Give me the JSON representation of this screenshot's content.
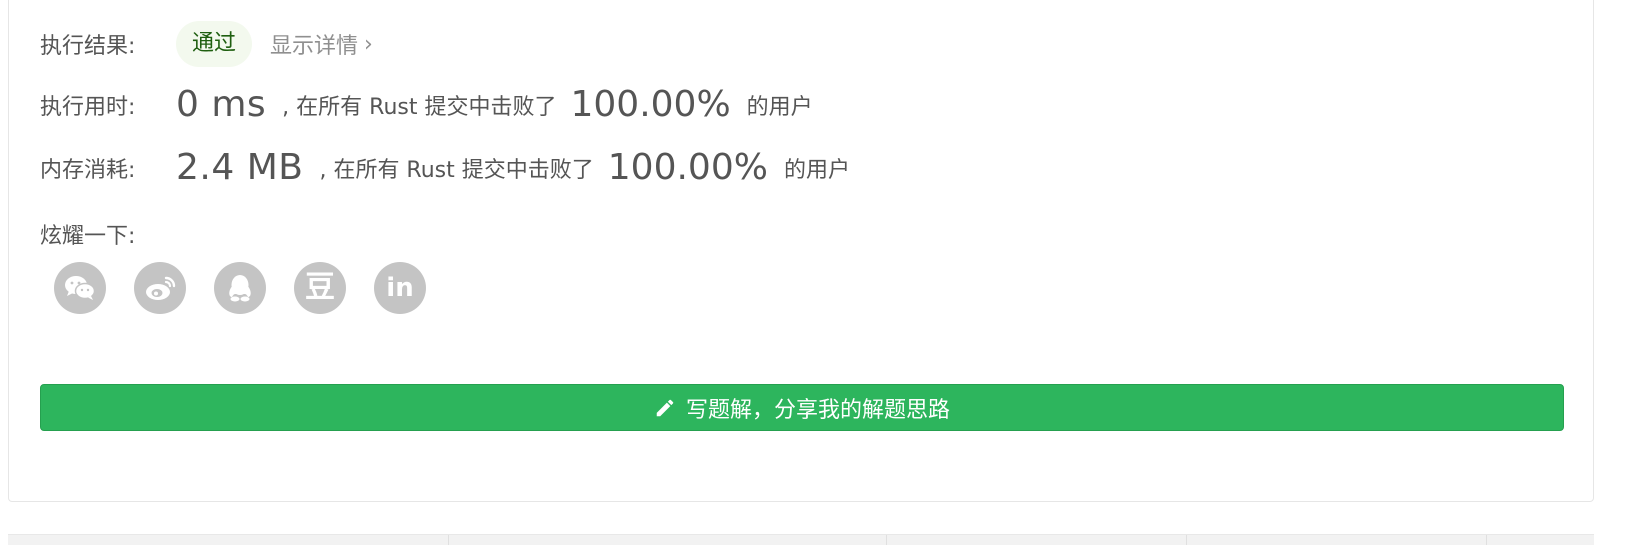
{
  "result": {
    "label": "执行结果:",
    "status": "通过",
    "details_link": "显示详情",
    "details_chevron": "›"
  },
  "runtime": {
    "label": "执行用时:",
    "value": "0 ms",
    "sentence": ", 在所有 Rust 提交中击败了",
    "percent": "100.00%",
    "tail": "的用户"
  },
  "memory": {
    "label": "内存消耗:",
    "value": "2.4 MB",
    "sentence": ", 在所有 Rust 提交中击败了",
    "percent": "100.00%",
    "tail": "的用户"
  },
  "share": {
    "label": "炫耀一下:",
    "icons": [
      "wechat-icon",
      "weibo-icon",
      "qq-icon",
      "douban-icon",
      "linkedin-icon"
    ],
    "douban_glyph": "豆",
    "linkedin_glyph": "in"
  },
  "write_solution": {
    "label": "写题解，分享我的解题思路",
    "icon": "pencil-icon"
  },
  "colors": {
    "accent_green": "#2db55d",
    "pill_bg": "#f3f9ee",
    "icon_gray": "#c4c4c4"
  }
}
